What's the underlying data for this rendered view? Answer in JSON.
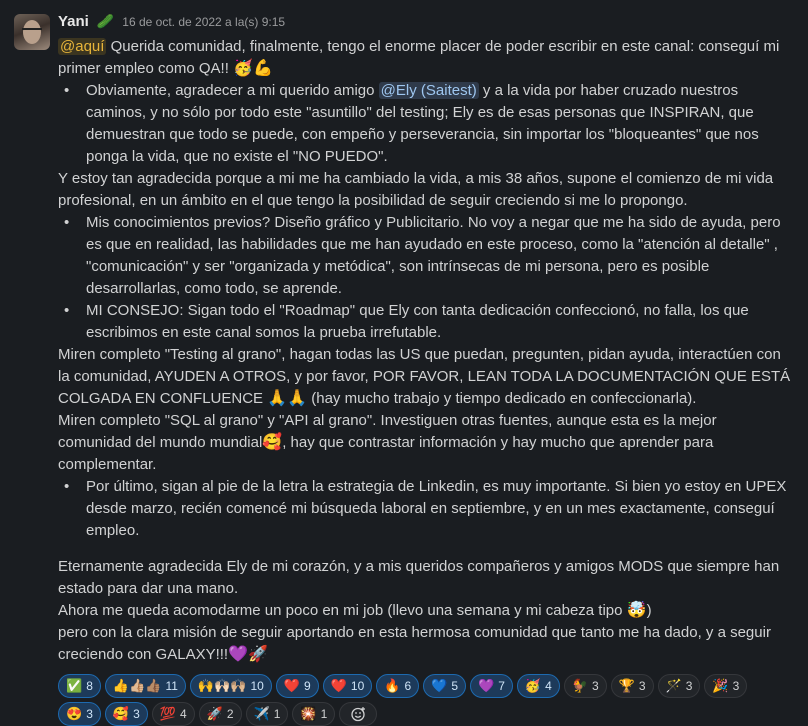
{
  "message": {
    "author": "Yani",
    "status_emoji": "🥒",
    "timestamp": "16 de oct. de 2022 a la(s) 9:15",
    "intro_mention": "@aquí",
    "intro_text": " Querida comunidad, finalmente, tengo el enorme placer de poder escribir en este canal: conseguí mi primer empleo como QA!! ",
    "intro_emoji": "🥳💪",
    "bullet1_pre": "Obviamente, agradecer a mi querido amigo ",
    "bullet1_mention": "@Ely (Saitest)",
    "bullet1_post": " y a la vida por haber cruzado nuestros caminos, y no sólo por todo este \"asuntillo\" del testing; Ely es de esas personas que INSPIRAN, que demuestran que todo se puede, con empeño y perseverancia, sin importar los \"bloqueantes\" que nos ponga la vida, que no existe el \"NO PUEDO\".",
    "para2": "Y estoy tan agradecida porque a mi me ha cambiado la vida, a mis 38 años, supone el comienzo de mi vida profesional, en un ámbito en el que tengo la posibilidad de seguir creciendo si me lo propongo.",
    "bullet2": "Mis conocimientos previos?  Diseño gráfico y Publicitario. No voy a negar que me ha sido de ayuda, pero es que en realidad, las habilidades que me han ayudado en este proceso, como la \"atención al detalle\" , \"comunicación\" y  ser \"organizada y metódica\", son intrínsecas de mi persona, pero es posible desarrollarlas, como todo, se aprende.",
    "bullet3": "MI CONSEJO: Sigan todo el \"Roadmap\" que Ely con tanta dedicación confeccionó, no falla, los que escribimos en este canal somos la prueba irrefutable.",
    "para3_text": "Miren completo \"Testing al grano\", hagan todas las US que puedan, pregunten, pidan ayuda, interactúen con la comunidad, AYUDEN A OTROS, y por favor, POR FAVOR, LEAN TODA LA DOCUMENTACIÓN QUE ESTÁ COLGADA EN CONFLUENCE ",
    "para3_emoji": "🙏🙏",
    "para3_tail": " (hay mucho trabajo y tiempo dedicado en confeccionarla).",
    "para4_text": "Miren completo \"SQL al grano\" y \"API al grano\". Investiguen otras fuentes, aunque esta es la mejor comunidad del mundo mundial",
    "para4_emoji": "🥰",
    "para4_tail": ", hay que contrastar información y hay mucho que aprender para complementar.",
    "bullet4": "Por último, sigan al pie de la letra la estrategia de Linkedin, es muy importante. Si bien yo estoy en UPEX desde marzo, recién comencé mi búsqueda laboral en septiembre, y en un mes exactamente, conseguí empleo.",
    "para5": "Eternamente agradecida Ely de mi corazón, y a mis queridos compañeros y amigos MODS que siempre han estado para dar una mano.",
    "para6_text": "Ahora me queda acomodarme un poco en mi job (llevo una semana y mi cabeza tipo ",
    "para6_emoji": "🤯",
    "para6_tail": ")",
    "para7_text": "pero con la clara misión de seguir aportando en esta hermosa comunidad que tanto me ha dado, y a seguir creciendo con GALAXY!!!",
    "para7_emoji": "💜🚀"
  },
  "reactions": [
    {
      "emoji": "✅",
      "count": "8",
      "active": true
    },
    {
      "emoji": "👍👍🏼👍🏽",
      "count": "11",
      "active": true
    },
    {
      "emoji": "🙌🙌🏻🙌🏼",
      "count": "10",
      "active": true
    },
    {
      "emoji": "❤️",
      "count": "9",
      "active": true
    },
    {
      "emoji": "❤️",
      "count": "10",
      "active": true
    },
    {
      "emoji": "🔥",
      "count": "6",
      "active": true
    },
    {
      "emoji": "💙",
      "count": "5",
      "active": true
    },
    {
      "emoji": "💜",
      "count": "7",
      "active": true
    },
    {
      "emoji": "🥳",
      "count": "4",
      "active": true
    },
    {
      "emoji": "🐓",
      "count": "3",
      "active": false
    },
    {
      "emoji": "🏆",
      "count": "3",
      "active": false
    },
    {
      "emoji": "🪄",
      "count": "3",
      "active": false
    },
    {
      "emoji": "🎉",
      "count": "3",
      "active": false
    },
    {
      "emoji": "😍",
      "count": "3",
      "active": true
    },
    {
      "emoji": "🥰",
      "count": "3",
      "active": true
    },
    {
      "emoji": "💯",
      "count": "4",
      "active": false
    },
    {
      "emoji": "🚀",
      "count": "2",
      "active": false
    },
    {
      "emoji": "✈️",
      "count": "1",
      "active": false
    },
    {
      "emoji": "🎇",
      "count": "1",
      "active": false
    }
  ],
  "add_reaction_icon": "add-emoji-icon"
}
